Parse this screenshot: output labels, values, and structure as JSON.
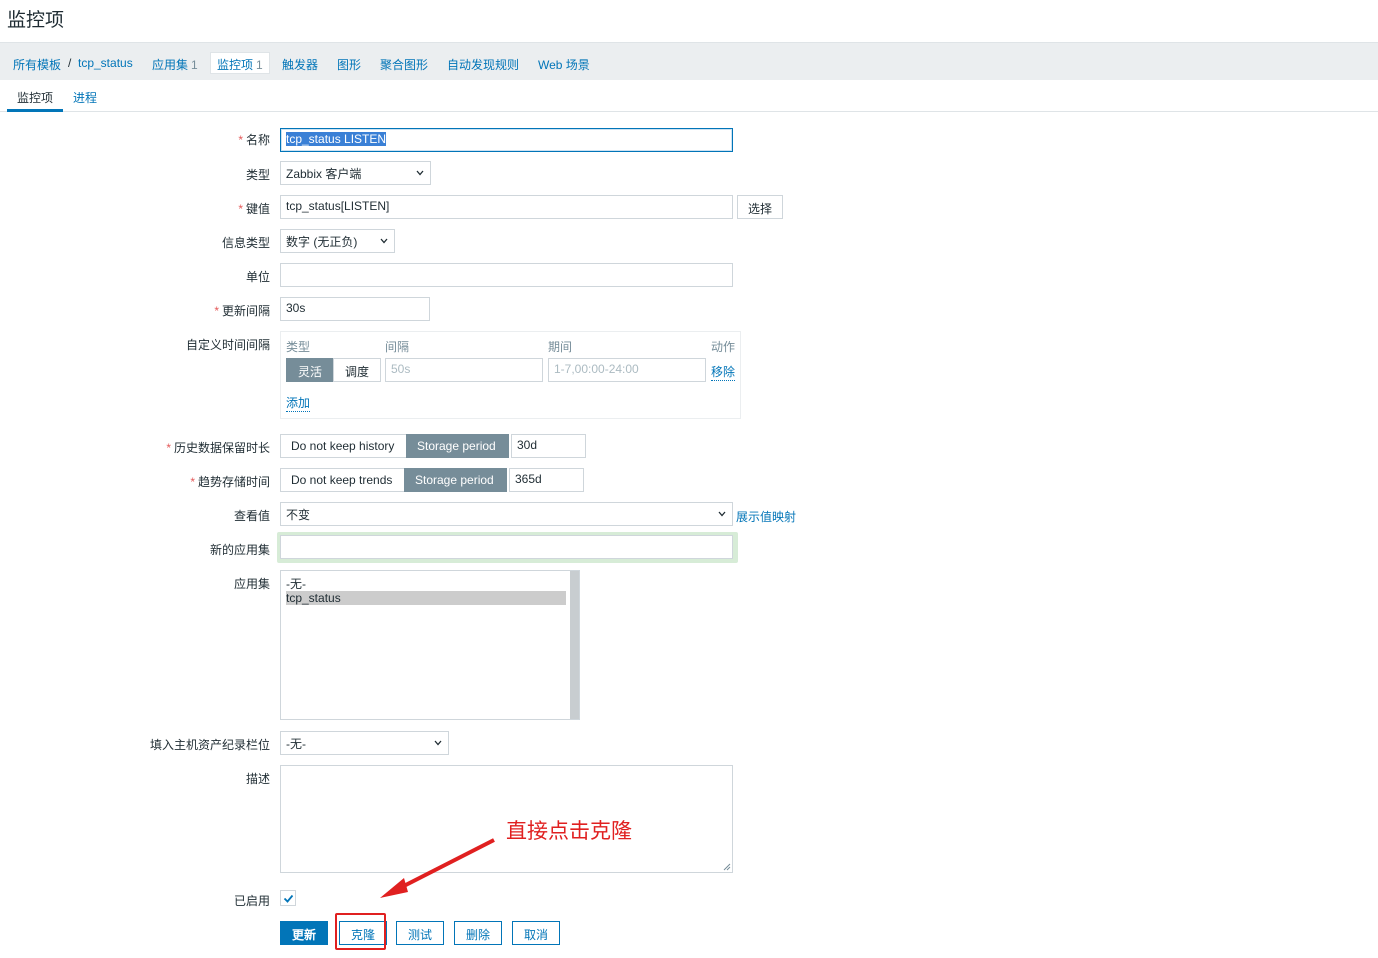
{
  "page_title": "监控项",
  "breadcrumb": {
    "all_templates": "所有模板",
    "separator": "/",
    "template": "tcp_status",
    "apps": "应用集",
    "apps_count": "1",
    "items": "监控项",
    "items_count": "1",
    "triggers": "触发器",
    "graphs": "图形",
    "screens": "聚合图形",
    "discovery": "自动发现规则",
    "web": "Web 场景"
  },
  "tabs": {
    "item": "监控项",
    "preprocessing": "进程"
  },
  "form": {
    "name": {
      "label": "名称",
      "value": "tcp_status LISTEN"
    },
    "type": {
      "label": "类型",
      "value": "Zabbix 客户端"
    },
    "key": {
      "label": "键值",
      "value": "tcp_status[LISTEN]",
      "select_button": "选择"
    },
    "info_type": {
      "label": "信息类型",
      "value": "数字 (无正负)"
    },
    "units": {
      "label": "单位",
      "value": ""
    },
    "update_interval": {
      "label": "更新间隔",
      "value": "30s"
    },
    "custom_intervals": {
      "label": "自定义时间间隔",
      "col_type": "类型",
      "col_interval": "间隔",
      "col_period": "期间",
      "col_action": "动作",
      "flexible": "灵活",
      "scheduling": "调度",
      "interval_placeholder": "50s",
      "period_placeholder": "1-7,00:00-24:00",
      "remove": "移除",
      "add": "添加"
    },
    "history": {
      "label": "历史数据保留时长",
      "no_keep": "Do not keep history",
      "storage": "Storage period",
      "value": "30d"
    },
    "trends": {
      "label": "趋势存储时间",
      "no_keep": "Do not keep trends",
      "storage": "Storage period",
      "value": "365d"
    },
    "valuemap": {
      "label": "查看值",
      "value": "不变",
      "link": "展示值映射"
    },
    "new_app": {
      "label": "新的应用集",
      "value": ""
    },
    "applications": {
      "label": "应用集",
      "options": [
        "-无-",
        "tcp_status"
      ],
      "selected": "tcp_status"
    },
    "inventory": {
      "label": "填入主机资产纪录栏位",
      "value": "-无-"
    },
    "description": {
      "label": "描述",
      "value": ""
    },
    "enabled": {
      "label": "已启用",
      "checked": true
    }
  },
  "buttons": {
    "update": "更新",
    "clone": "克隆",
    "test": "测试",
    "delete": "删除",
    "cancel": "取消"
  },
  "annotation": {
    "text": "直接点击克隆",
    "color": "#e02020"
  },
  "colors": {
    "accent": "#0275b8",
    "required": "#e45959",
    "annotation": "#e02020"
  }
}
